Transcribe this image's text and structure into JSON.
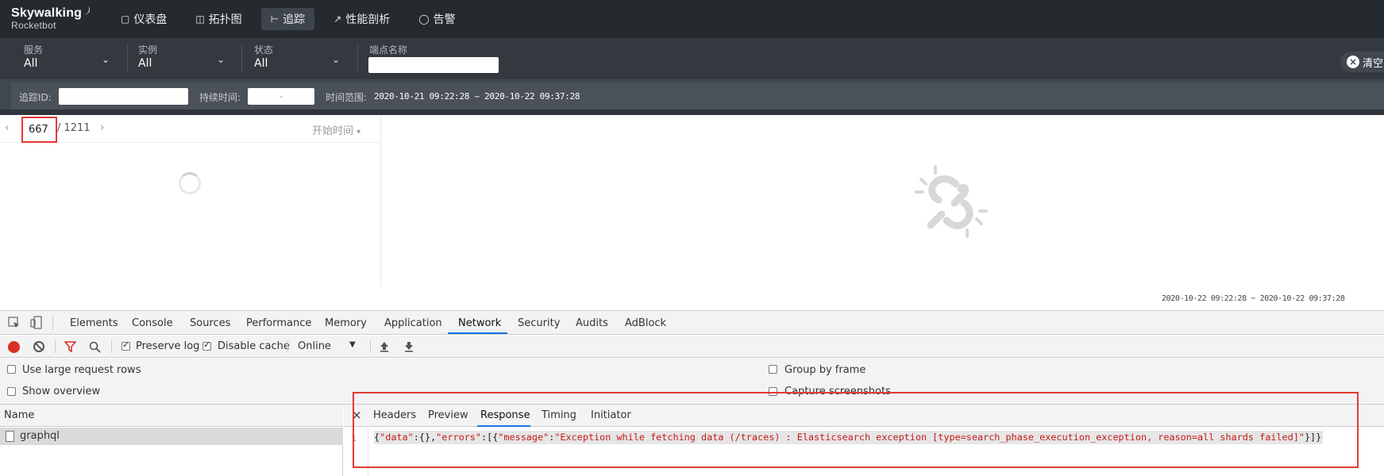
{
  "app": {
    "logo_top": "Skywalking",
    "logo_bottom": "Rocketbot"
  },
  "nav": [
    {
      "label": "仪表盘",
      "icon": "dashboard-icon"
    },
    {
      "label": "拓扑图",
      "icon": "topology-icon"
    },
    {
      "label": "追踪",
      "icon": "trace-icon",
      "active": true
    },
    {
      "label": "性能剖析",
      "icon": "profile-icon"
    },
    {
      "label": "告警",
      "icon": "alarm-icon"
    }
  ],
  "filters": {
    "service": {
      "label": "服务",
      "value": "All"
    },
    "instance": {
      "label": "实例",
      "value": "All"
    },
    "status": {
      "label": "状态",
      "value": "All"
    },
    "endpoint": {
      "label": "端点名称",
      "value": ""
    },
    "clear_label": "清空"
  },
  "filters2": {
    "trace_id_label": "追踪ID:",
    "trace_id_value": "",
    "duration_label": "持续时间:",
    "duration_value": "-",
    "time_range_label": "时间范围:",
    "time_range_value": "2020-10-21 09:22:28 ~ 2020-10-22 09:37:28"
  },
  "trace_list": {
    "page_current": "667",
    "page_total": "/ 1211",
    "sort_label": "开始时间"
  },
  "footer_time_range": "2020-10-22 09:22:28 ~ 2020-10-22 09:37:28",
  "devtools": {
    "tabs": [
      "Elements",
      "Console",
      "Sources",
      "Performance",
      "Memory",
      "Application",
      "Network",
      "Security",
      "Audits",
      "AdBlock"
    ],
    "active_tab": "Network",
    "preserve_log": "Preserve log",
    "disable_cache": "Disable cache",
    "throttle": "Online",
    "options": {
      "large_rows": "Use large request rows",
      "overview": "Show overview",
      "group_frame": "Group by frame",
      "capture": "Capture screenshots"
    },
    "name_header": "Name",
    "request_name": "graphql",
    "detail_tabs": [
      "Headers",
      "Preview",
      "Response",
      "Timing",
      "Initiator"
    ],
    "active_detail_tab": "Response",
    "response_line_number": "1",
    "response": {
      "p1": "{",
      "k1": "\"data\"",
      "p2": ":{},",
      "k2": "\"errors\"",
      "p3": ":[{",
      "k3": "\"message\"",
      "p4": ":",
      "k4": "\"Exception while fetching data (/traces) : Elasticsearch exception [type=search_phase_execution_exception, reason=all shards failed]\"",
      "p5": "}]}"
    }
  },
  "colors": {
    "topbar": "#252a2f",
    "filterbar": "#33393f",
    "highlight_box": "#e53935",
    "devtools_accent": "#1a73e8",
    "json_key": "#c41a16"
  }
}
